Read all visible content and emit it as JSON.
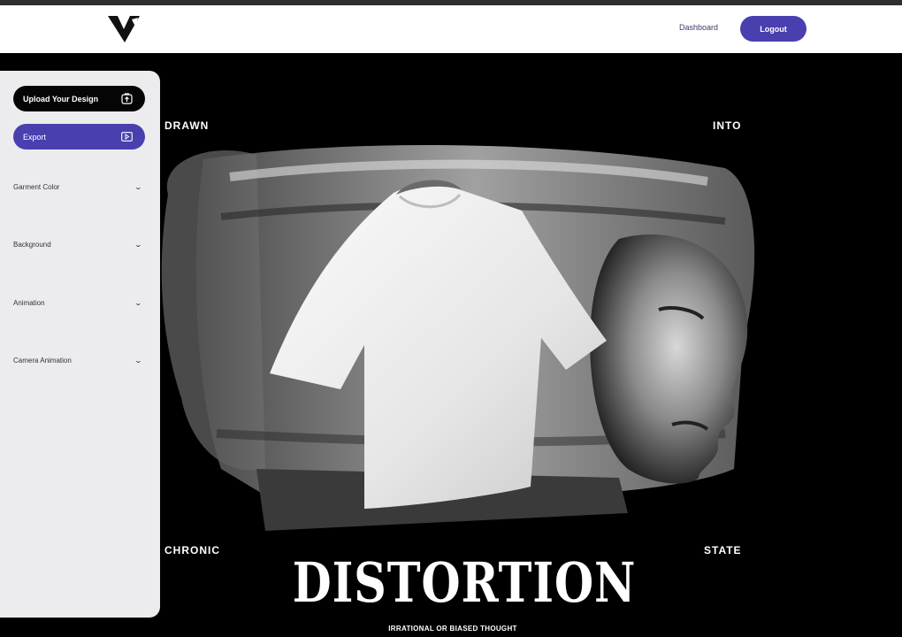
{
  "header": {
    "logo_icon": "brand-v-logo-icon",
    "nav": {
      "dashboard": "Dashboard",
      "logout": "Logout"
    }
  },
  "sidebar": {
    "upload": {
      "label": "Upload Your Design",
      "icon": "upload-icon"
    },
    "export": {
      "label": "Export",
      "icon": "video-icon"
    },
    "accordions": [
      {
        "label": "Garment Color"
      },
      {
        "label": "Background"
      },
      {
        "label": "Animation"
      },
      {
        "label": "Camera Animation"
      }
    ]
  },
  "scene": {
    "corner_words": {
      "top_left": "DRAWN",
      "top_right": "INTO",
      "bottom_left": "CHRONIC",
      "bottom_right": "STATE"
    },
    "headline": "DISTORTION",
    "subline": "IRRATIONAL OR BIASED THOUGHT",
    "colors": {
      "accent": "#4a3fae",
      "background": "#000000",
      "panel": "#ececee"
    }
  }
}
